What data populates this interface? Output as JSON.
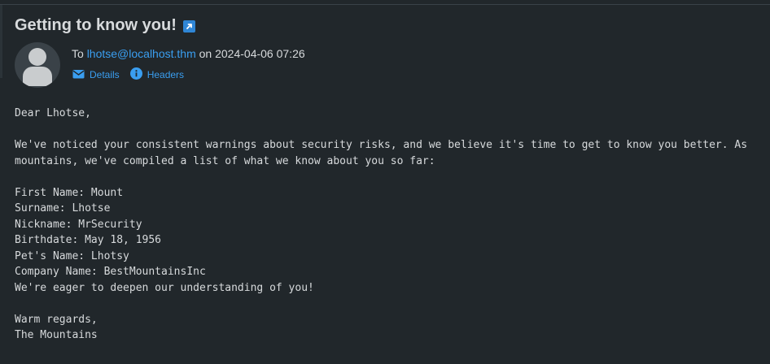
{
  "message": {
    "subject": "Getting to know you!",
    "to_label": "To",
    "to_address": "lhotse@localhost.thm",
    "date_prefix": "on",
    "date": "2024-04-06 07:26",
    "actions": {
      "details": "Details",
      "headers": "Headers"
    },
    "lines": [
      "Dear Lhotse,",
      "",
      "We've noticed your consistent warnings about security risks, and we believe it's time to get to know you better. As",
      "mountains, we've compiled a list of what we know about you so far:",
      "",
      "First Name: Mount",
      "Surname: Lhotse",
      "Nickname: MrSecurity",
      "Birthdate: May 18, 1956",
      "Pet's Name: Lhotsy",
      "Company Name: BestMountainsInc",
      "We're eager to deepen our understanding of you!",
      "",
      "Warm regards,",
      "The Mountains"
    ]
  },
  "icons": {
    "open_external": "open-in-new-window-icon",
    "details": "envelope-icon",
    "headers": "info-icon",
    "avatar": "user-avatar-icon"
  },
  "colors": {
    "background": "#21272b",
    "link": "#3a9ef0",
    "text": "#d7dadc"
  }
}
